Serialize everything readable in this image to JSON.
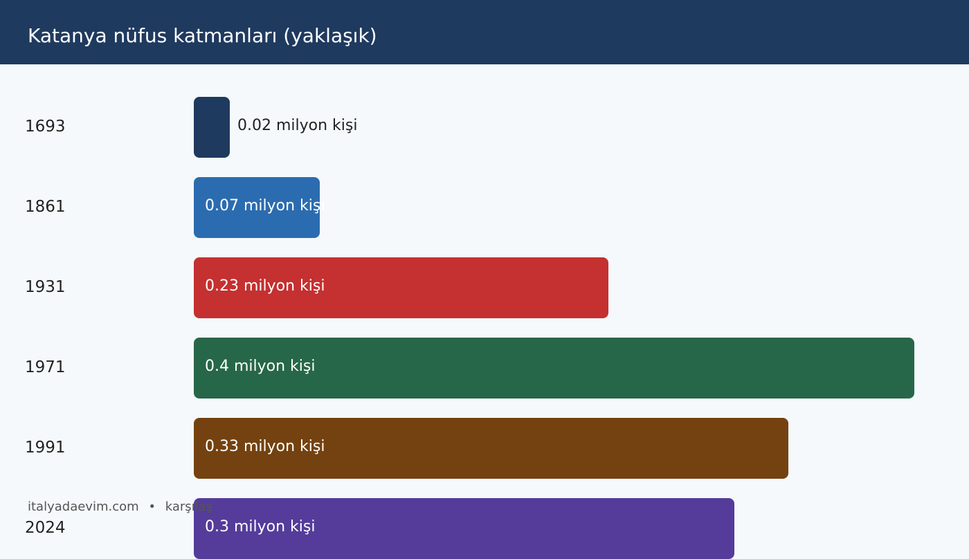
{
  "header": {
    "title": "Katanya nüfus katmanları (yaklaşık)"
  },
  "footer": {
    "site": "italyadaevim.com",
    "separator": "•",
    "note": "karşılaş"
  },
  "chart_data": {
    "type": "bar",
    "orientation": "horizontal",
    "title": "Katanya nüfus katmanları (yaklaşık)",
    "categories": [
      "1693",
      "1861",
      "1931",
      "1971",
      "1991",
      "2024"
    ],
    "values": [
      0.02,
      0.07,
      0.23,
      0.4,
      0.33,
      0.3
    ],
    "value_labels": [
      "0.02 milyon kişi",
      "0.07 milyon kişi",
      "0.23 milyon kişi",
      "0.4 milyon kişi",
      "0.33 milyon kişi",
      "0.3 milyon kişi"
    ],
    "colors": [
      "#1e3a5f",
      "#2b6cb0",
      "#c53030",
      "#276749",
      "#744210",
      "#553c9a"
    ],
    "xlim": [
      0,
      0.4
    ],
    "grid": false,
    "legend": "none"
  }
}
